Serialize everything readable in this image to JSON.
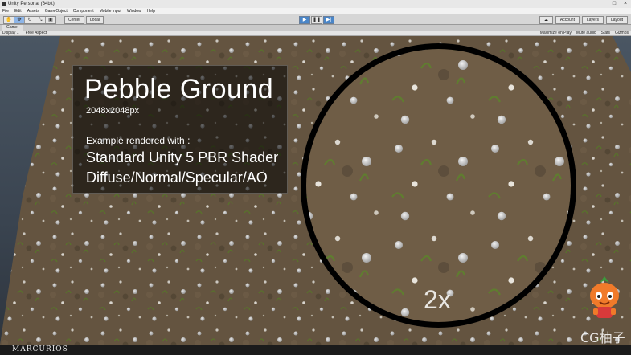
{
  "window": {
    "title": "Unity Personal (64bit)",
    "controls": [
      "_",
      "□",
      "×"
    ]
  },
  "menu": [
    "File",
    "Edit",
    "Assets",
    "GameObject",
    "Component",
    "Mobile Input",
    "Window",
    "Help"
  ],
  "toolbar": {
    "pivot": "Center",
    "space": "Local",
    "account": "Account",
    "layers": "Layers",
    "layout": "Layout"
  },
  "game_tab": {
    "label": "Game",
    "display": "Display 1",
    "aspect": "Free Aspect",
    "maximize": "Maximize on Play",
    "mute": "Mute audio",
    "stats": "Stats",
    "gizmos": "Gizmos"
  },
  "overlay": {
    "title": "Pebble Ground",
    "resolution": "2048x2048px",
    "example_label": "Example rendered with :",
    "shader": "Standard Unity 5 PBR Shader",
    "maps": "Diffuse/Normal/Specular/AO",
    "zoom": "2x"
  },
  "watermark": "CG柚子",
  "brand": "MARCURIOS",
  "colors": {
    "ground": "#6b5a44",
    "play_active": "#4a86c8",
    "brand_bar": "#1b1b1b"
  }
}
